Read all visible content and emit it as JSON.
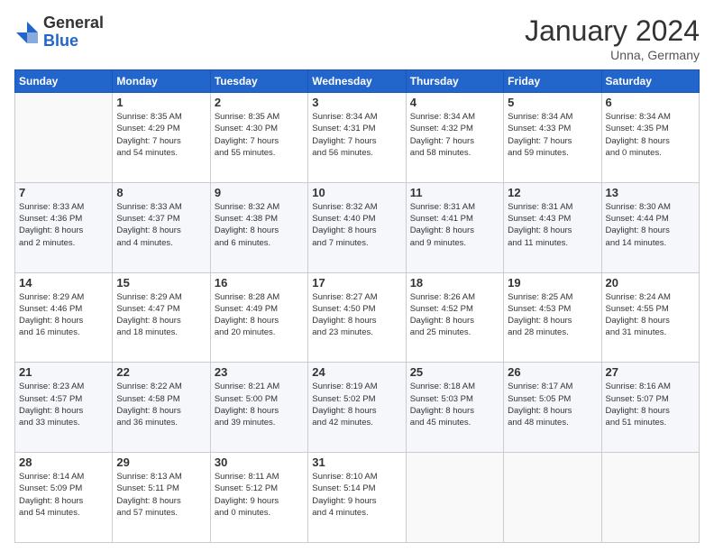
{
  "header": {
    "logo": {
      "line1": "General",
      "line2": "Blue"
    },
    "title": "January 2024",
    "location": "Unna, Germany"
  },
  "weekdays": [
    "Sunday",
    "Monday",
    "Tuesday",
    "Wednesday",
    "Thursday",
    "Friday",
    "Saturday"
  ],
  "weeks": [
    [
      {
        "day": "",
        "info": ""
      },
      {
        "day": "1",
        "info": "Sunrise: 8:35 AM\nSunset: 4:29 PM\nDaylight: 7 hours\nand 54 minutes."
      },
      {
        "day": "2",
        "info": "Sunrise: 8:35 AM\nSunset: 4:30 PM\nDaylight: 7 hours\nand 55 minutes."
      },
      {
        "day": "3",
        "info": "Sunrise: 8:34 AM\nSunset: 4:31 PM\nDaylight: 7 hours\nand 56 minutes."
      },
      {
        "day": "4",
        "info": "Sunrise: 8:34 AM\nSunset: 4:32 PM\nDaylight: 7 hours\nand 58 minutes."
      },
      {
        "day": "5",
        "info": "Sunrise: 8:34 AM\nSunset: 4:33 PM\nDaylight: 7 hours\nand 59 minutes."
      },
      {
        "day": "6",
        "info": "Sunrise: 8:34 AM\nSunset: 4:35 PM\nDaylight: 8 hours\nand 0 minutes."
      }
    ],
    [
      {
        "day": "7",
        "info": "Sunrise: 8:33 AM\nSunset: 4:36 PM\nDaylight: 8 hours\nand 2 minutes."
      },
      {
        "day": "8",
        "info": "Sunrise: 8:33 AM\nSunset: 4:37 PM\nDaylight: 8 hours\nand 4 minutes."
      },
      {
        "day": "9",
        "info": "Sunrise: 8:32 AM\nSunset: 4:38 PM\nDaylight: 8 hours\nand 6 minutes."
      },
      {
        "day": "10",
        "info": "Sunrise: 8:32 AM\nSunset: 4:40 PM\nDaylight: 8 hours\nand 7 minutes."
      },
      {
        "day": "11",
        "info": "Sunrise: 8:31 AM\nSunset: 4:41 PM\nDaylight: 8 hours\nand 9 minutes."
      },
      {
        "day": "12",
        "info": "Sunrise: 8:31 AM\nSunset: 4:43 PM\nDaylight: 8 hours\nand 11 minutes."
      },
      {
        "day": "13",
        "info": "Sunrise: 8:30 AM\nSunset: 4:44 PM\nDaylight: 8 hours\nand 14 minutes."
      }
    ],
    [
      {
        "day": "14",
        "info": "Sunrise: 8:29 AM\nSunset: 4:46 PM\nDaylight: 8 hours\nand 16 minutes."
      },
      {
        "day": "15",
        "info": "Sunrise: 8:29 AM\nSunset: 4:47 PM\nDaylight: 8 hours\nand 18 minutes."
      },
      {
        "day": "16",
        "info": "Sunrise: 8:28 AM\nSunset: 4:49 PM\nDaylight: 8 hours\nand 20 minutes."
      },
      {
        "day": "17",
        "info": "Sunrise: 8:27 AM\nSunset: 4:50 PM\nDaylight: 8 hours\nand 23 minutes."
      },
      {
        "day": "18",
        "info": "Sunrise: 8:26 AM\nSunset: 4:52 PM\nDaylight: 8 hours\nand 25 minutes."
      },
      {
        "day": "19",
        "info": "Sunrise: 8:25 AM\nSunset: 4:53 PM\nDaylight: 8 hours\nand 28 minutes."
      },
      {
        "day": "20",
        "info": "Sunrise: 8:24 AM\nSunset: 4:55 PM\nDaylight: 8 hours\nand 31 minutes."
      }
    ],
    [
      {
        "day": "21",
        "info": "Sunrise: 8:23 AM\nSunset: 4:57 PM\nDaylight: 8 hours\nand 33 minutes."
      },
      {
        "day": "22",
        "info": "Sunrise: 8:22 AM\nSunset: 4:58 PM\nDaylight: 8 hours\nand 36 minutes."
      },
      {
        "day": "23",
        "info": "Sunrise: 8:21 AM\nSunset: 5:00 PM\nDaylight: 8 hours\nand 39 minutes."
      },
      {
        "day": "24",
        "info": "Sunrise: 8:19 AM\nSunset: 5:02 PM\nDaylight: 8 hours\nand 42 minutes."
      },
      {
        "day": "25",
        "info": "Sunrise: 8:18 AM\nSunset: 5:03 PM\nDaylight: 8 hours\nand 45 minutes."
      },
      {
        "day": "26",
        "info": "Sunrise: 8:17 AM\nSunset: 5:05 PM\nDaylight: 8 hours\nand 48 minutes."
      },
      {
        "day": "27",
        "info": "Sunrise: 8:16 AM\nSunset: 5:07 PM\nDaylight: 8 hours\nand 51 minutes."
      }
    ],
    [
      {
        "day": "28",
        "info": "Sunrise: 8:14 AM\nSunset: 5:09 PM\nDaylight: 8 hours\nand 54 minutes."
      },
      {
        "day": "29",
        "info": "Sunrise: 8:13 AM\nSunset: 5:11 PM\nDaylight: 8 hours\nand 57 minutes."
      },
      {
        "day": "30",
        "info": "Sunrise: 8:11 AM\nSunset: 5:12 PM\nDaylight: 9 hours\nand 0 minutes."
      },
      {
        "day": "31",
        "info": "Sunrise: 8:10 AM\nSunset: 5:14 PM\nDaylight: 9 hours\nand 4 minutes."
      },
      {
        "day": "",
        "info": ""
      },
      {
        "day": "",
        "info": ""
      },
      {
        "day": "",
        "info": ""
      }
    ]
  ]
}
